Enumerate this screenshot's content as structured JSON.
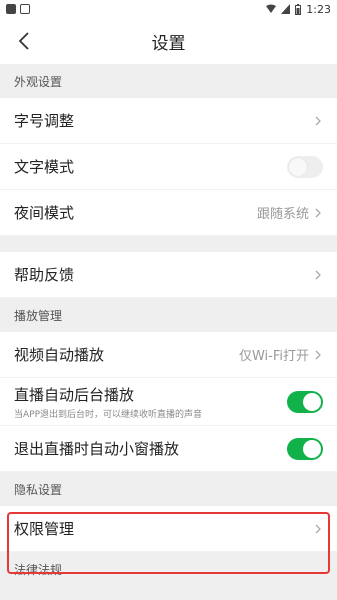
{
  "statusbar": {
    "time": "1:23"
  },
  "navbar": {
    "title": "设置"
  },
  "sections": {
    "appearance": {
      "header": "外观设置",
      "font_size": "字号调整",
      "text_mode": "文字模式",
      "night_mode": "夜间模式",
      "night_mode_value": "跟随系统"
    },
    "help": {
      "feedback": "帮助反馈"
    },
    "playback": {
      "header": "播放管理",
      "video_autoplay": "视频自动播放",
      "video_autoplay_value": "仅Wi-Fi打开",
      "live_background": "直播自动后台播放",
      "live_background_desc": "当APP退出到后台时，可以继续收听直播的声音",
      "live_pip": "退出直播时自动小窗播放"
    },
    "privacy": {
      "header": "隐私设置",
      "permissions": "权限管理"
    },
    "legal": {
      "header": "法律法规"
    }
  },
  "colors": {
    "accent_green": "#12b24b",
    "highlight_red": "#e53935"
  }
}
